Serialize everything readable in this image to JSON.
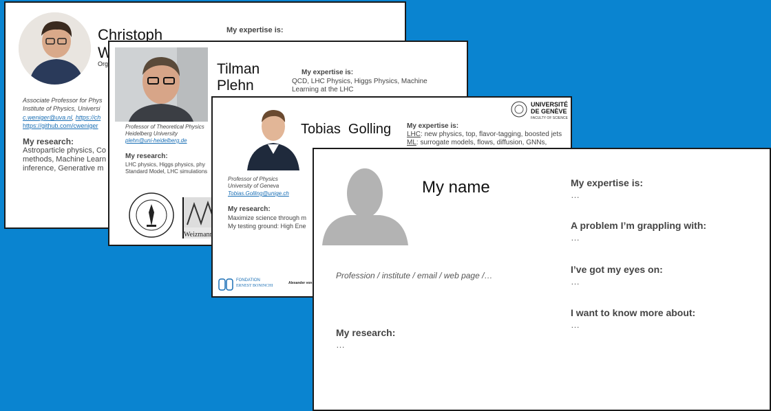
{
  "colors": {
    "background": "#0a84d0"
  },
  "slide1": {
    "name_line1": "Christoph",
    "name_line2": "W",
    "org": "Org",
    "expertise_heading": "My expertise is:",
    "position": "Associate Professor for Phys",
    "institute": "Institute of Physics, Universi",
    "email": "c.weniger@uva.nl",
    "email_sep": ", ",
    "web": "https://ch",
    "github": "https://github.com/cweniger",
    "research_heading": "My research:",
    "research_line1": "Astroparticle physics, Co",
    "research_line2": "methods, Machine Learn",
    "research_line3": "inference, Generative m"
  },
  "slide2": {
    "name_line1": "Tilman",
    "name_line2": "Plehn",
    "expertise_heading": "My expertise is:",
    "expertise_line1": "QCD, LHC Physics, Higgs Physics, Machine",
    "expertise_line2": "Learning at the LHC",
    "position": "Professor of Theoretical Physics",
    "institute": "Heidelberg University",
    "email": "plehn@uni-heidelberg.de",
    "research_heading": "My research:",
    "research_line1": "LHC physics, Higgs physics, phy",
    "research_line2": "Standard Model, LHC simulations",
    "logo1_text": "CALIFORNIA INSTITUTE OF TECHNOLOGY",
    "logo1_year": "1891",
    "logo2_text": "Weizmann Ins"
  },
  "slide3": {
    "name": "Tobias  Golling",
    "uni_line1": "UNIVERSITÉ",
    "uni_line2": "DE GENÈVE",
    "uni_line3": "FACULTY OF SCIENCE",
    "expertise_heading": "My expertise is:",
    "expertise1_tag": "LHC",
    "expertise1_text": ": new physics, top, flavor-tagging, boosted jets",
    "expertise2_tag": "ML",
    "expertise2_text": ": surrogate models, flows, diffusion, GNNs,",
    "position": "Professor of Physics",
    "institute": "University of Geneva",
    "email": "Tobias.Golling@unige.ch",
    "research_heading": "My research:",
    "research_line1": "Maximize science through m",
    "research_line2": "My testing ground: High Ene",
    "footer_logo_line1": "FONDATION",
    "footer_logo_line2": "ERNEST BONINCHI",
    "footer_text": "Alexander von H"
  },
  "slide4": {
    "name": "My name",
    "profession": "Profession / institute / email / web page /…",
    "research_heading": "My research:",
    "research_value": "…",
    "q1_heading": "My expertise is:",
    "q1_value": "…",
    "q2_heading": "A problem I’m grappling with:",
    "q2_value": "…",
    "q3_heading": "I’ve got my eyes on:",
    "q3_value": "…",
    "q4_heading": "I want to know more about:",
    "q4_value": "…"
  }
}
